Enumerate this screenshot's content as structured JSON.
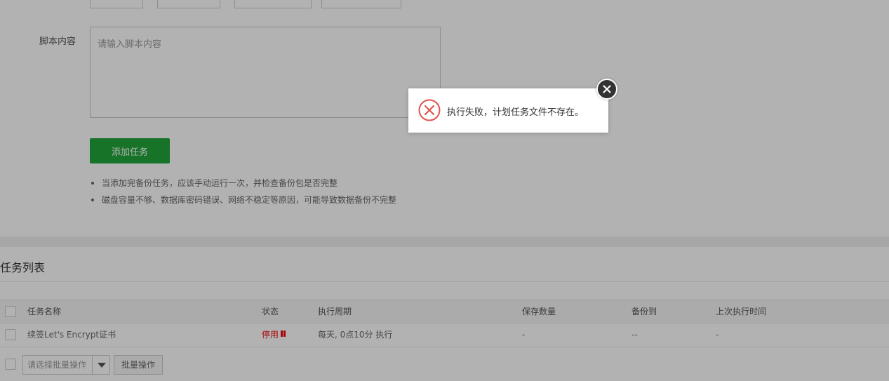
{
  "form": {
    "script_label": "脚本内容",
    "script_placeholder": "请输入脚本内容",
    "add_button": "添加任务",
    "tips": [
      "当添加完备份任务，应该手动运行一次，并检查备份包是否完整",
      "磁盘容量不够、数据库密码错误、网络不稳定等原因，可能导致数据备份不完整"
    ]
  },
  "task_list": {
    "title": "任务列表",
    "columns": [
      "任务名称",
      "状态",
      "执行周期",
      "保存数量",
      "备份到",
      "上次执行时间"
    ],
    "rows": [
      {
        "name": "续签Let's Encrypt证书",
        "status": "停用",
        "cycle": "每天, 0点10分 执行",
        "keep": "-",
        "backup_to": "--",
        "last_run": "-"
      }
    ],
    "batch_placeholder": "请选择批量操作",
    "batch_button": "批量操作"
  },
  "dialog": {
    "message": "执行失败，计划任务文件不存在。",
    "icon": "error-circle-icon",
    "close_icon": "close-icon"
  },
  "colors": {
    "primary_green": "#20a53a",
    "status_red": "#ef0808",
    "error_icon": "#e2534b"
  }
}
